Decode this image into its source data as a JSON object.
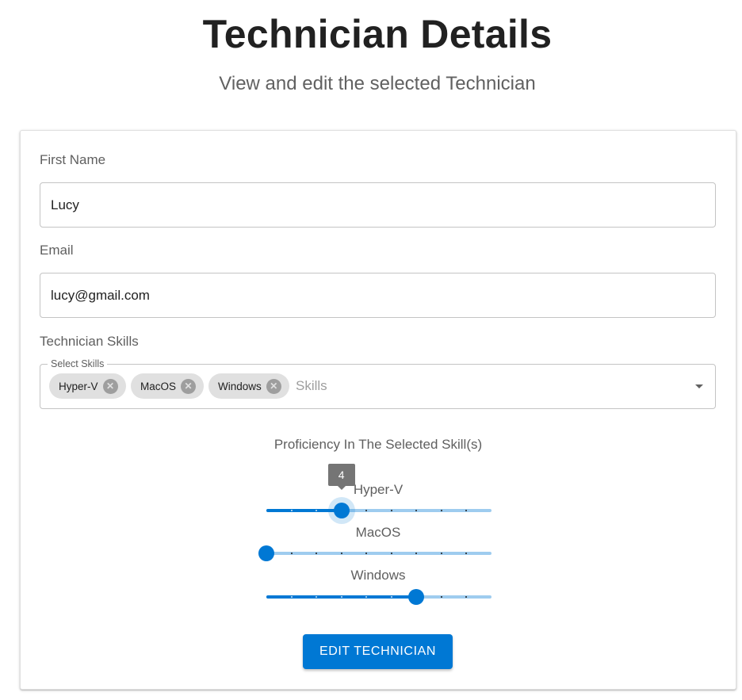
{
  "page": {
    "title": "Technician Details",
    "subtitle": "View and edit the selected Technician"
  },
  "form": {
    "first_name": {
      "label": "First Name",
      "value": "Lucy"
    },
    "email": {
      "label": "Email",
      "value": "lucy@gmail.com"
    },
    "skills": {
      "label": "Technician Skills",
      "legend": "Select Skills",
      "placeholder": "Skills",
      "chips": [
        {
          "label": "Hyper-V",
          "delete_icon": "cancel-icon"
        },
        {
          "label": "MacOS",
          "delete_icon": "cancel-icon"
        },
        {
          "label": "Windows",
          "delete_icon": "cancel-icon"
        }
      ],
      "dropdown_icon": "arrow-drop-down-icon"
    },
    "proficiency": {
      "heading": "Proficiency In The Selected Skill(s)",
      "min": 1,
      "max": 10,
      "sliders": [
        {
          "label": "Hyper-V",
          "value": 4,
          "value_label_visible": true
        },
        {
          "label": "MacOS",
          "value": 1,
          "value_label_visible": false
        },
        {
          "label": "Windows",
          "value": 7,
          "value_label_visible": false
        }
      ]
    },
    "submit": {
      "label": "EDIT TECHNICIAN"
    }
  },
  "colors": {
    "accent": "#0078d4",
    "chip_background": "#e0e0e0",
    "value_label_background": "#757575"
  }
}
